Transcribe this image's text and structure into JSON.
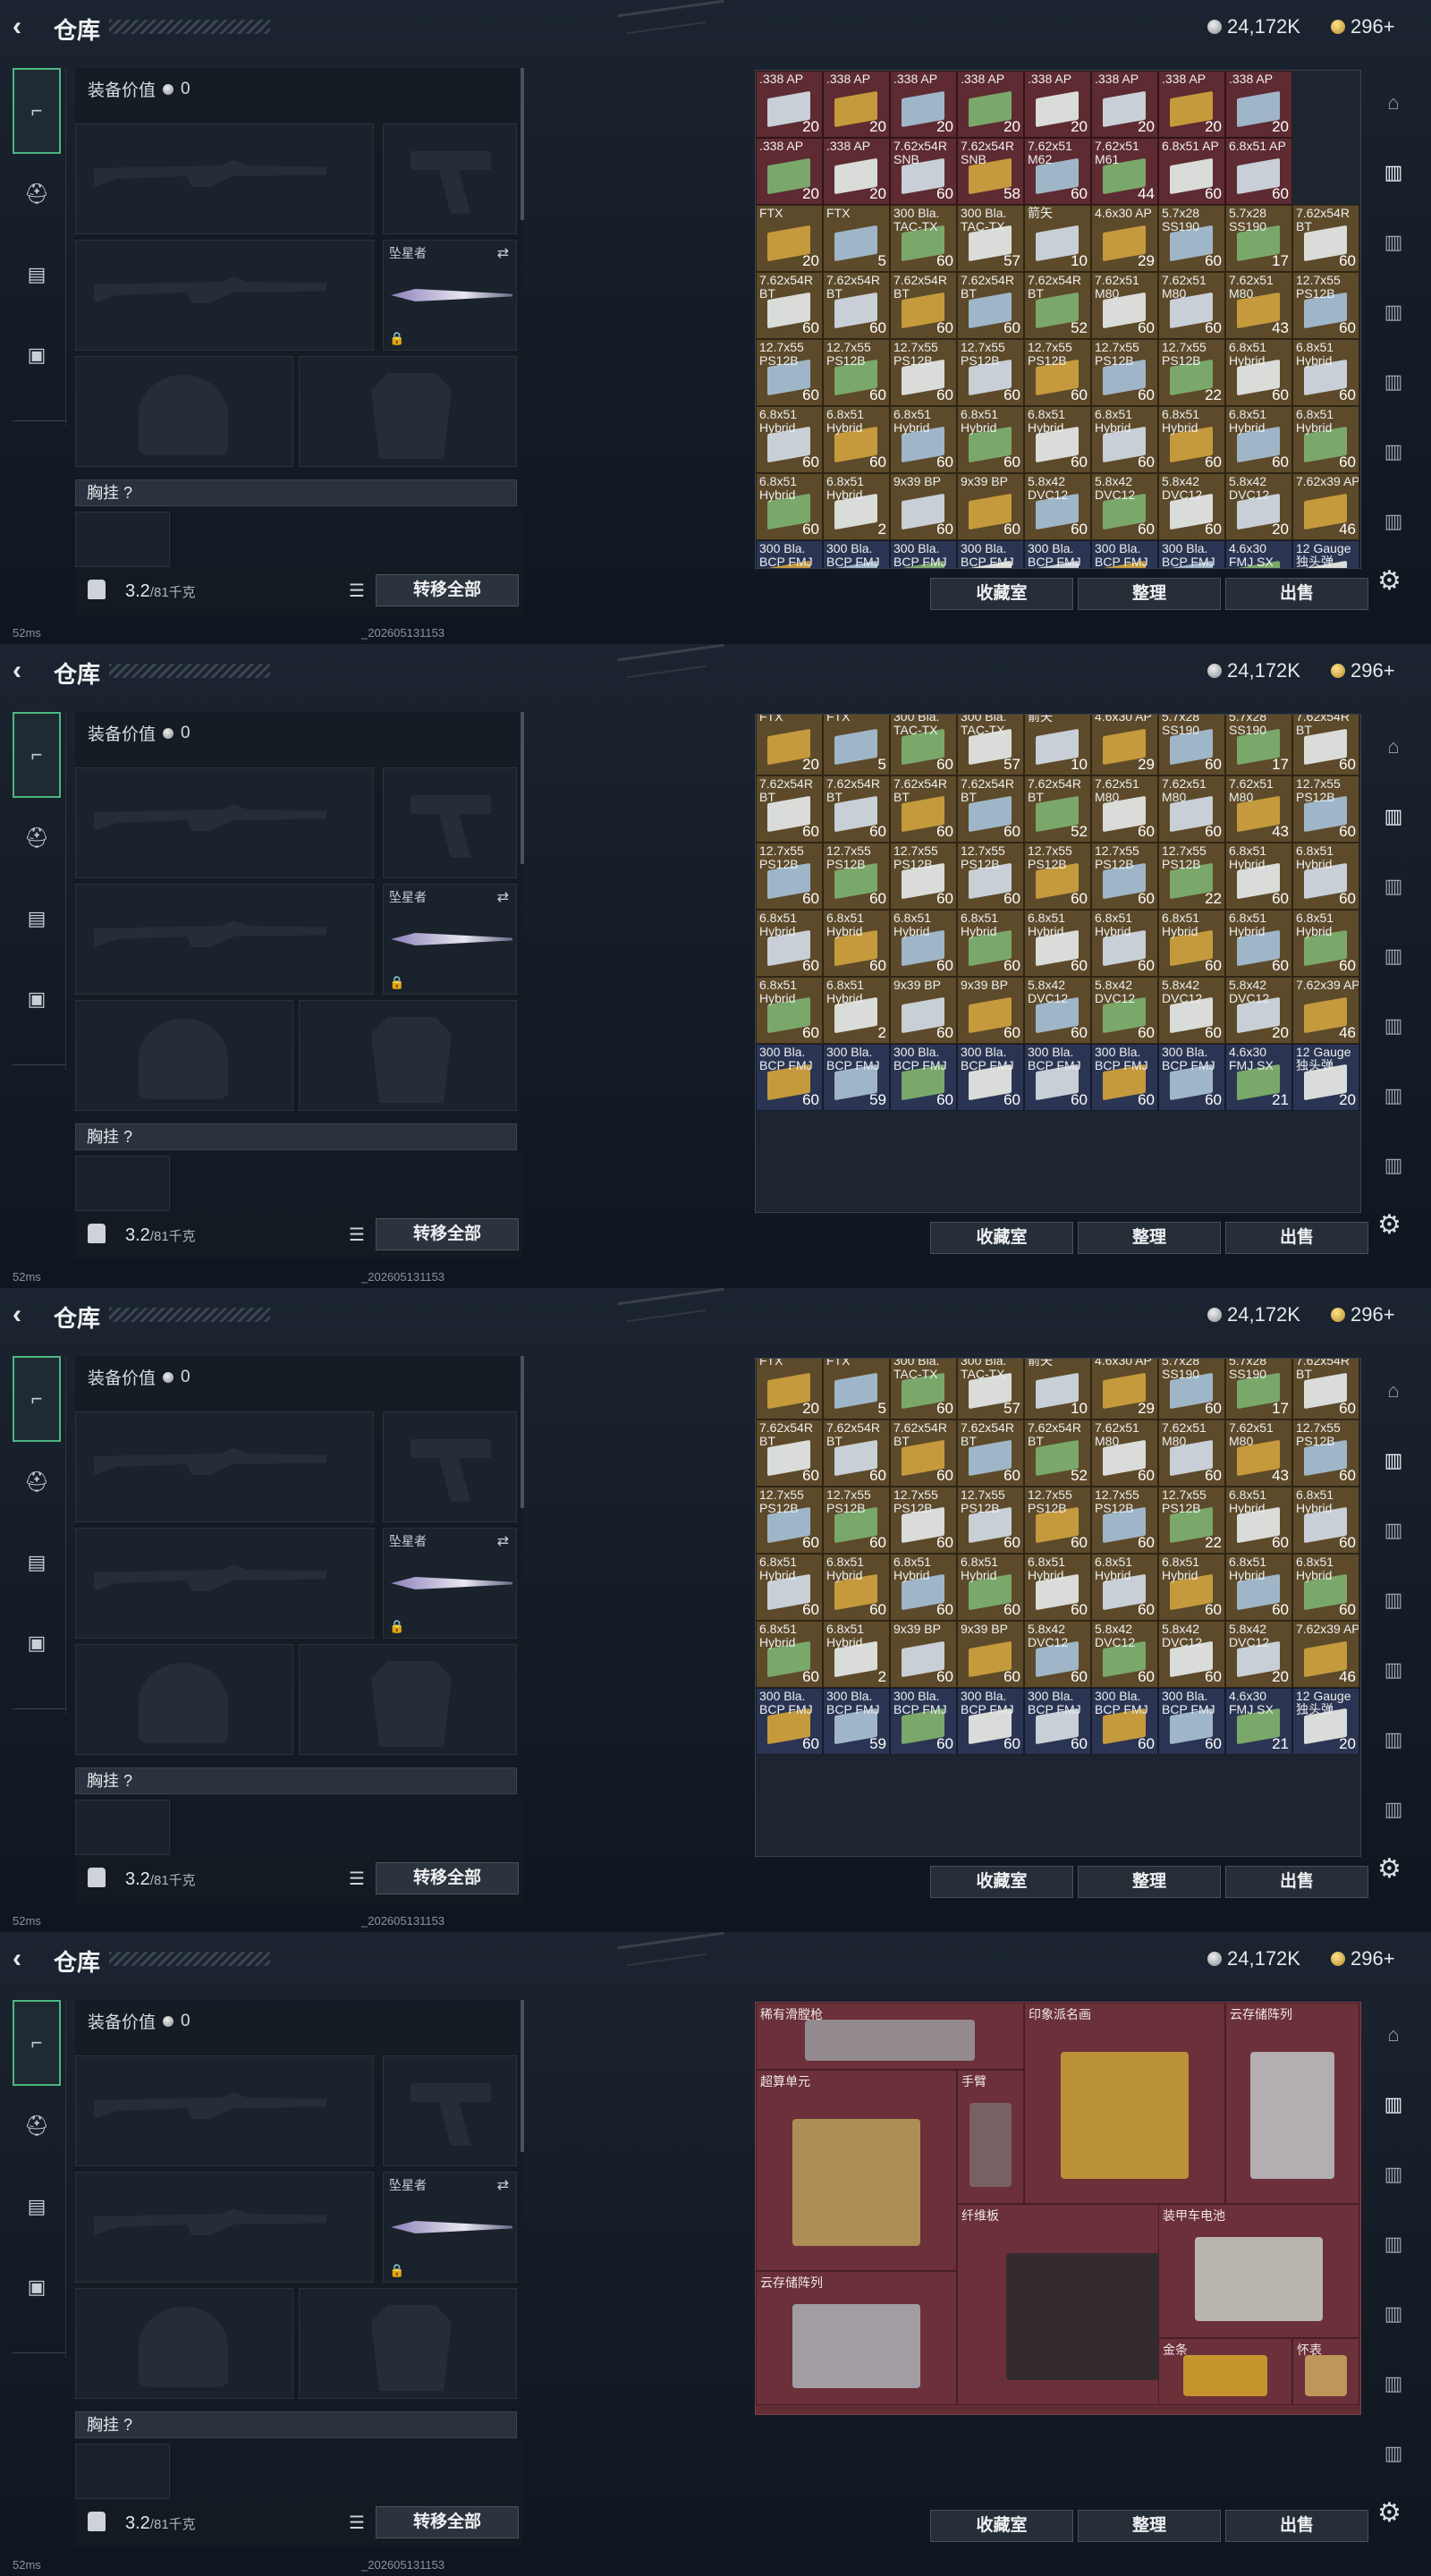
{
  "header": {
    "title": "仓库",
    "silver": "24,172K",
    "gold": "296+"
  },
  "left": {
    "equip_value_label": "装备价值",
    "equip_value": "0",
    "melee_label": "坠星者",
    "chest_label": "胸挂 ?",
    "weight": "3.2",
    "weight_cap": "/81千克",
    "transfer_all": "转移全部"
  },
  "actions": {
    "favorites": "收藏室",
    "sort": "整理",
    "sell": "出售"
  },
  "status": {
    "ping": "52ms",
    "version": "_202605131153"
  },
  "colors": {
    "accent": "#4cb782",
    "ammo_red": "#5e2b32",
    "ammo_orange": "#5d4a2a",
    "ammo_blue": "#2b3553",
    "loot_bg": "#642d36"
  },
  "ammo_rows": [
    [
      {
        "n": ".338 AP",
        "c": "20",
        "t": "r"
      },
      {
        "n": ".338 AP",
        "c": "20",
        "t": "r"
      },
      {
        "n": ".338 AP",
        "c": "20",
        "t": "r"
      },
      {
        "n": ".338 AP",
        "c": "20",
        "t": "r"
      },
      {
        "n": ".338 AP",
        "c": "20",
        "t": "r"
      },
      {
        "n": ".338 AP",
        "c": "20",
        "t": "r"
      },
      {
        "n": ".338 AP",
        "c": "20",
        "t": "r"
      },
      {
        "n": ".338 AP",
        "c": "20",
        "t": "r"
      }
    ],
    [
      {
        "n": ".338 AP",
        "c": "20",
        "t": "r"
      },
      {
        "n": ".338 AP",
        "c": "20",
        "t": "r"
      },
      {
        "n": "7.62x54R SNB",
        "c": "60",
        "t": "r"
      },
      {
        "n": "7.62x54R SNB",
        "c": "58",
        "t": "r"
      },
      {
        "n": "7.62x51 M62",
        "c": "60",
        "t": "r"
      },
      {
        "n": "7.62x51 M61",
        "c": "44",
        "t": "r"
      },
      {
        "n": "6.8x51 AP",
        "c": "60",
        "t": "r"
      },
      {
        "n": "6.8x51 AP",
        "c": "60",
        "t": "r"
      }
    ],
    [
      {
        "n": "FTX",
        "c": "20",
        "t": "o"
      },
      {
        "n": "FTX",
        "c": "5",
        "t": "o"
      },
      {
        "n": "300 Bla. TAC-TX",
        "c": "60",
        "t": "o"
      },
      {
        "n": "300 Bla. TAC-TX",
        "c": "57",
        "t": "o"
      },
      {
        "n": "箭矢",
        "c": "10",
        "t": "o"
      },
      {
        "n": "4.6x30 AP",
        "c": "29",
        "t": "o"
      },
      {
        "n": "5.7x28 SS190",
        "c": "60",
        "t": "o"
      },
      {
        "n": "5.7x28 SS190",
        "c": "17",
        "t": "o"
      },
      {
        "n": "7.62x54R BT",
        "c": "60",
        "t": "o"
      }
    ],
    [
      {
        "n": "7.62x54R BT",
        "c": "60",
        "t": "o"
      },
      {
        "n": "7.62x54R BT",
        "c": "60",
        "t": "o"
      },
      {
        "n": "7.62x54R BT",
        "c": "60",
        "t": "o"
      },
      {
        "n": "7.62x54R BT",
        "c": "60",
        "t": "o"
      },
      {
        "n": "7.62x54R BT",
        "c": "52",
        "t": "o"
      },
      {
        "n": "7.62x51 M80",
        "c": "60",
        "t": "o"
      },
      {
        "n": "7.62x51 M80",
        "c": "60",
        "t": "o"
      },
      {
        "n": "7.62x51 M80",
        "c": "43",
        "t": "o"
      },
      {
        "n": "12.7x55 PS12B",
        "c": "60",
        "t": "o"
      }
    ],
    [
      {
        "n": "12.7x55 PS12B",
        "c": "60",
        "t": "o"
      },
      {
        "n": "12.7x55 PS12B",
        "c": "60",
        "t": "o"
      },
      {
        "n": "12.7x55 PS12B",
        "c": "60",
        "t": "o"
      },
      {
        "n": "12.7x55 PS12B",
        "c": "60",
        "t": "o"
      },
      {
        "n": "12.7x55 PS12B",
        "c": "60",
        "t": "o"
      },
      {
        "n": "12.7x55 PS12B",
        "c": "60",
        "t": "o"
      },
      {
        "n": "12.7x55 PS12B",
        "c": "22",
        "t": "o"
      },
      {
        "n": "6.8x51 Hybrid",
        "c": "60",
        "t": "o"
      },
      {
        "n": "6.8x51 Hybrid",
        "c": "60",
        "t": "o"
      }
    ],
    [
      {
        "n": "6.8x51 Hybrid",
        "c": "60",
        "t": "o"
      },
      {
        "n": "6.8x51 Hybrid",
        "c": "60",
        "t": "o"
      },
      {
        "n": "6.8x51 Hybrid",
        "c": "60",
        "t": "o"
      },
      {
        "n": "6.8x51 Hybrid",
        "c": "60",
        "t": "o"
      },
      {
        "n": "6.8x51 Hybrid",
        "c": "60",
        "t": "o"
      },
      {
        "n": "6.8x51 Hybrid",
        "c": "60",
        "t": "o"
      },
      {
        "n": "6.8x51 Hybrid",
        "c": "60",
        "t": "o"
      },
      {
        "n": "6.8x51 Hybrid",
        "c": "60",
        "t": "o"
      },
      {
        "n": "6.8x51 Hybrid",
        "c": "60",
        "t": "o"
      }
    ],
    [
      {
        "n": "6.8x51 Hybrid",
        "c": "60",
        "t": "o"
      },
      {
        "n": "6.8x51 Hybrid",
        "c": "2",
        "t": "o"
      },
      {
        "n": "9x39 BP",
        "c": "60",
        "t": "o"
      },
      {
        "n": "9x39 BP",
        "c": "60",
        "t": "o"
      },
      {
        "n": "5.8x42 DVC12",
        "c": "60",
        "t": "o"
      },
      {
        "n": "5.8x42 DVC12",
        "c": "60",
        "t": "o"
      },
      {
        "n": "5.8x42 DVC12",
        "c": "60",
        "t": "o"
      },
      {
        "n": "5.8x42 DVC12",
        "c": "20",
        "t": "o"
      },
      {
        "n": "7.62x39 AP",
        "c": "46",
        "t": "o"
      }
    ],
    [
      {
        "n": "300 Bla. BCP FMJ",
        "c": "60",
        "t": "b"
      },
      {
        "n": "300 Bla. BCP FMJ",
        "c": "59",
        "t": "b"
      },
      {
        "n": "300 Bla. BCP FMJ",
        "c": "60",
        "t": "b"
      },
      {
        "n": "300 Bla. BCP FMJ",
        "c": "60",
        "t": "b"
      },
      {
        "n": "300 Bla. BCP FMJ",
        "c": "60",
        "t": "b"
      },
      {
        "n": "300 Bla. BCP FMJ",
        "c": "60",
        "t": "b"
      },
      {
        "n": "300 Bla. BCP FMJ",
        "c": "60",
        "t": "b"
      },
      {
        "n": "4.6x30 FMJ SX",
        "c": "21",
        "t": "b"
      },
      {
        "n": "12 Gauge 独头弹",
        "c": "20",
        "t": "b"
      }
    ]
  ],
  "loot": [
    {
      "n": "稀有滑膛枪"
    },
    {
      "n": "印象派名画"
    },
    {
      "n": "云存储阵列"
    },
    {
      "n": "超算单元"
    },
    {
      "n": "手臂"
    },
    {
      "n": "纤维板"
    },
    {
      "n": "装甲车电池"
    },
    {
      "n": "云存储阵列"
    },
    {
      "n": "金条"
    },
    {
      "n": "怀表"
    }
  ]
}
